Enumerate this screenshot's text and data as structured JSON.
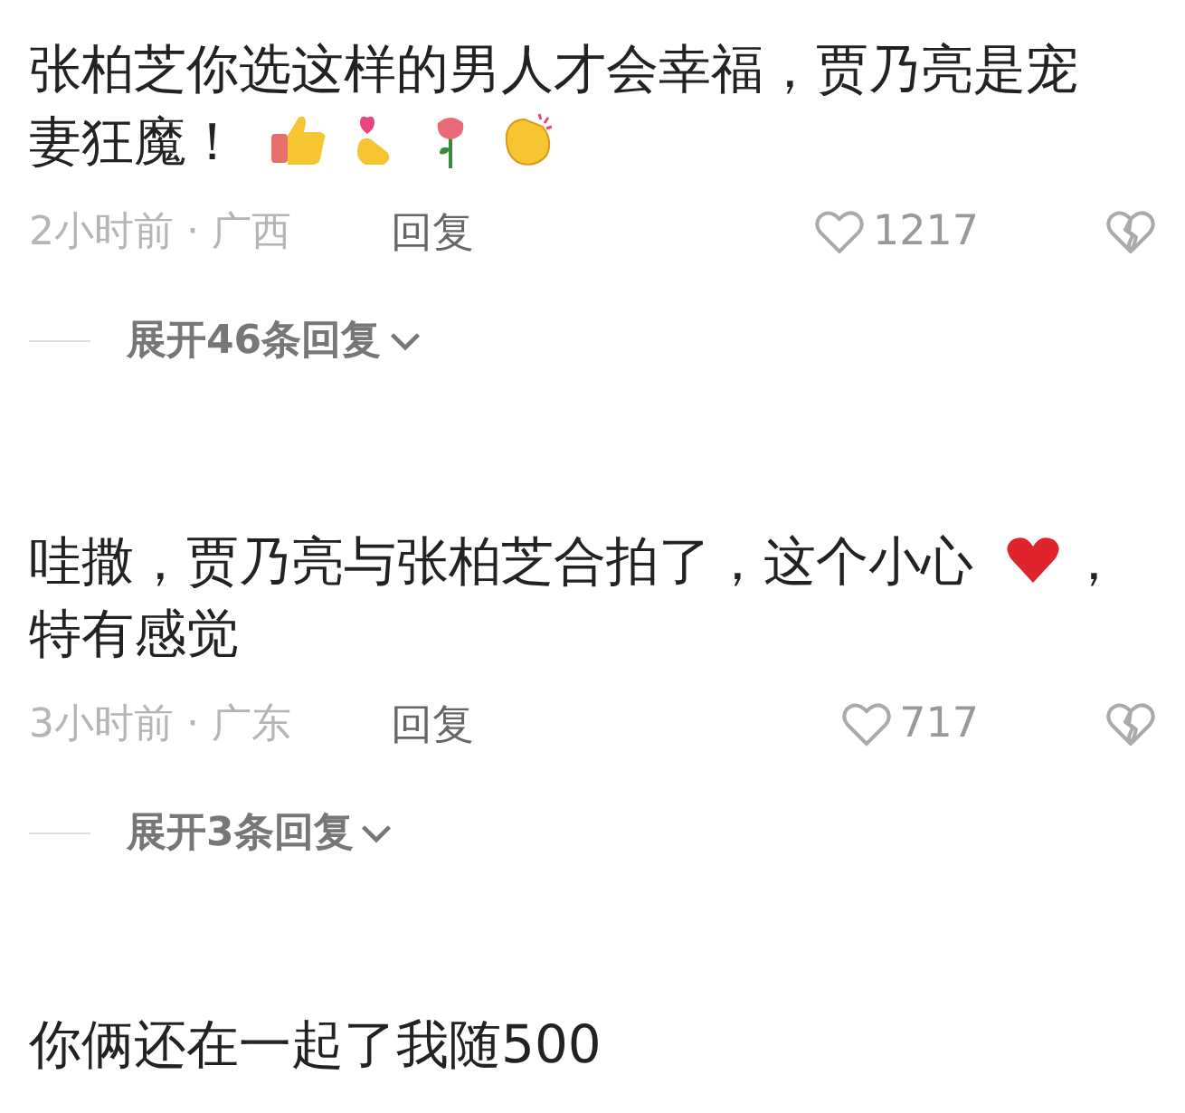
{
  "comments": [
    {
      "text": "张柏芝你选这样的男人才会幸福，贾乃亮是宠妻狂魔！",
      "time": "2小时前 · 广西",
      "reply": "回复",
      "likes": "1217",
      "expand": "展开46条回复"
    },
    {
      "text": "哇撒，贾乃亮与张柏芝合拍了，这个小心",
      "text_after": "，特有感觉",
      "time": "3小时前 · 广东",
      "reply": "回复",
      "likes": "717",
      "expand": "展开3条回复"
    },
    {
      "text": "你俩还在一起了我随500"
    }
  ]
}
